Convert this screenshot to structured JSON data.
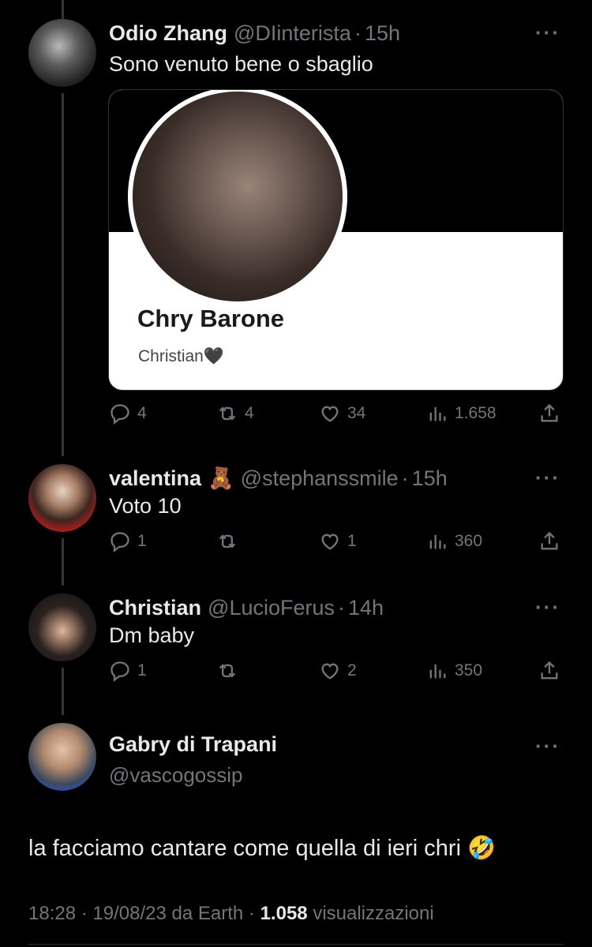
{
  "thread": [
    {
      "name": "Odio Zhang",
      "handle": "@DIinterista",
      "time": "15h",
      "text": "Sono venuto bene o sbaglio",
      "card": {
        "name": "Chry Barone",
        "subtitle": "Christian🖤"
      },
      "replies": "4",
      "retweets": "4",
      "likes": "34",
      "views": "1.658"
    },
    {
      "name": "valentina",
      "emoji": "🧸",
      "handle": "@stephanssmile",
      "time": "15h",
      "text": "Voto 10",
      "replies": "1",
      "retweets": "",
      "likes": "1",
      "views": "360"
    },
    {
      "name": "Christian",
      "handle": "@LucioFerus",
      "time": "14h",
      "text": "Dm baby",
      "replies": "1",
      "retweets": "",
      "likes": "2",
      "views": "350"
    }
  ],
  "main": {
    "name": "Gabry di Trapani",
    "handle": "@vascogossip",
    "text": "la facciamo cantare come quella di ieri chri 🤣",
    "time": "18:28",
    "date": "19/08/23",
    "via": "da Earth",
    "views": "1.058",
    "views_label": "visualizzazioni"
  },
  "icons": [
    "reply-icon",
    "retweet-icon",
    "like-icon",
    "views-icon",
    "share-icon",
    "more-icon"
  ],
  "colors": {
    "background": "#000000",
    "text": "#e7e9ea",
    "muted": "#71767b",
    "line": "#333639"
  }
}
